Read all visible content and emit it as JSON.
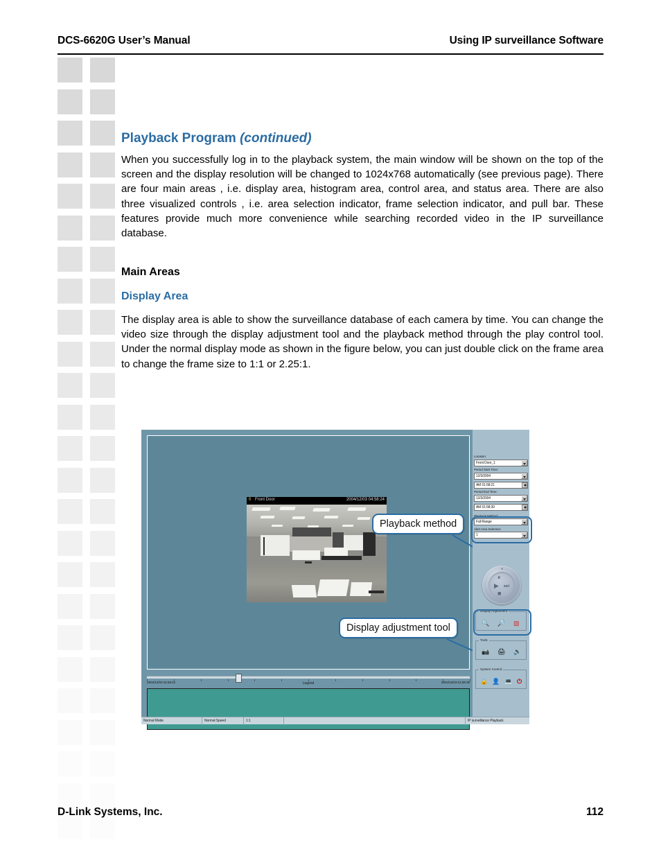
{
  "header": {
    "left": "DCS-6620G User’s Manual",
    "right": "Using IP surveillance Software"
  },
  "footer": {
    "company": "D-Link Systems, Inc.",
    "page_number": "112"
  },
  "content": {
    "section_title": "Playback Program",
    "section_title_continued": "(continued)",
    "intro_paragraph": "When you successfully log in to the playback system, the main window will be shown on the top of the screen and the display resolution will be changed to 1024x768 automatically (see previous page). There are four main areas , i.e. display area, histogram area, control area, and status area. There are also three visualized controls , i.e. area selection indicator, frame selection indicator, and pull bar. These features provide much more convenience while searching recorded video in the IP surveillance database.",
    "main_areas_heading": "Main Areas",
    "display_area_heading": "Display Area",
    "display_area_paragraph": "The display area is able to show the surveillance database of each camera by time. You can change the video size through the display adjustment tool and the playback method through the play control tool. Under the normal display mode as shown in the figure below, you can just double click on the frame area to change the frame size to 1:1 or 2.25:1."
  },
  "figure": {
    "video": {
      "channel": "0",
      "camera_name": "Front Door",
      "timestamp": "2004/12/03 04:58:24"
    },
    "callouts": [
      {
        "label": "Playback method"
      },
      {
        "label": "Display adjustment tool"
      }
    ],
    "control_panel": {
      "location_label": "Location:",
      "location_value": "Front Door_1",
      "period_start_label": "Period Start Time:",
      "period_start_date": "12/3/2004",
      "period_start_time": "AM 01:58:21",
      "period_end_label": "Period End Time:",
      "period_end_date": "12/3/2004",
      "period_end_time": "AM 01:58:39",
      "playback_method_label": "Playback Method:",
      "playback_method_value": "Full Range",
      "alert_area_label": "Alert Area Selection:",
      "alert_area_value": "1",
      "display_adjustment_title": "Display Adjustment",
      "tools_title": "Tools",
      "system_control_title": "System Control"
    },
    "play_control": {
      "pause": "⏸",
      "play": "▶",
      "next_frame": "⏭",
      "stop": "■"
    },
    "display_adjustment_icons": [
      "zoom-in-icon",
      "zoom-out-icon",
      "color-palette-icon"
    ],
    "tools_icons": [
      "snapshot-camera-icon",
      "print-icon",
      "audio-icon"
    ],
    "system_control_icons": [
      "lock-icon",
      "user-config-icon",
      "monitor-icon",
      "power-icon"
    ],
    "histogram": {
      "legend_label": "Legend",
      "axis_start": "2004/12/03 01:58:21",
      "axis_end": "2004/12/03 01:58:39"
    },
    "status_bar": {
      "mode": "Normal Mode",
      "speed": "Normal Speed",
      "ratio": "1:1",
      "app": "IP surveillance Playback"
    }
  },
  "colors": {
    "accent_blue": "#2b6ca3",
    "figure_bg": "#6f96a8",
    "panel_bg": "#a7bfcd",
    "histogram": "#3f9b92"
  }
}
